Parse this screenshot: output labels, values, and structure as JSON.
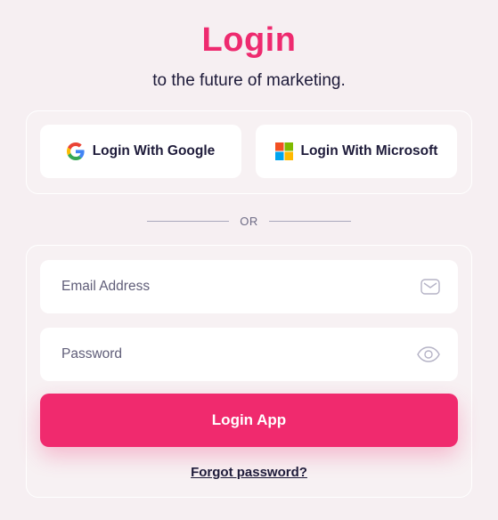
{
  "header": {
    "title": "Login",
    "subtitle": "to the future of marketing."
  },
  "social": {
    "google_label": "Login With Google",
    "microsoft_label": "Login With Microsoft",
    "google_icon": "google-icon",
    "microsoft_icon": "microsoft-icon"
  },
  "divider": {
    "text": "OR"
  },
  "form": {
    "email": {
      "value": "",
      "placeholder": "Email Address",
      "icon": "mail-icon"
    },
    "password": {
      "value": "",
      "placeholder": "Password",
      "icon": "eye-icon"
    },
    "submit_label": "Login App",
    "forgot_label": "Forgot password?"
  },
  "colors": {
    "accent": "#f02a6e",
    "background": "#f6eff2",
    "text": "#1e1b3a"
  }
}
